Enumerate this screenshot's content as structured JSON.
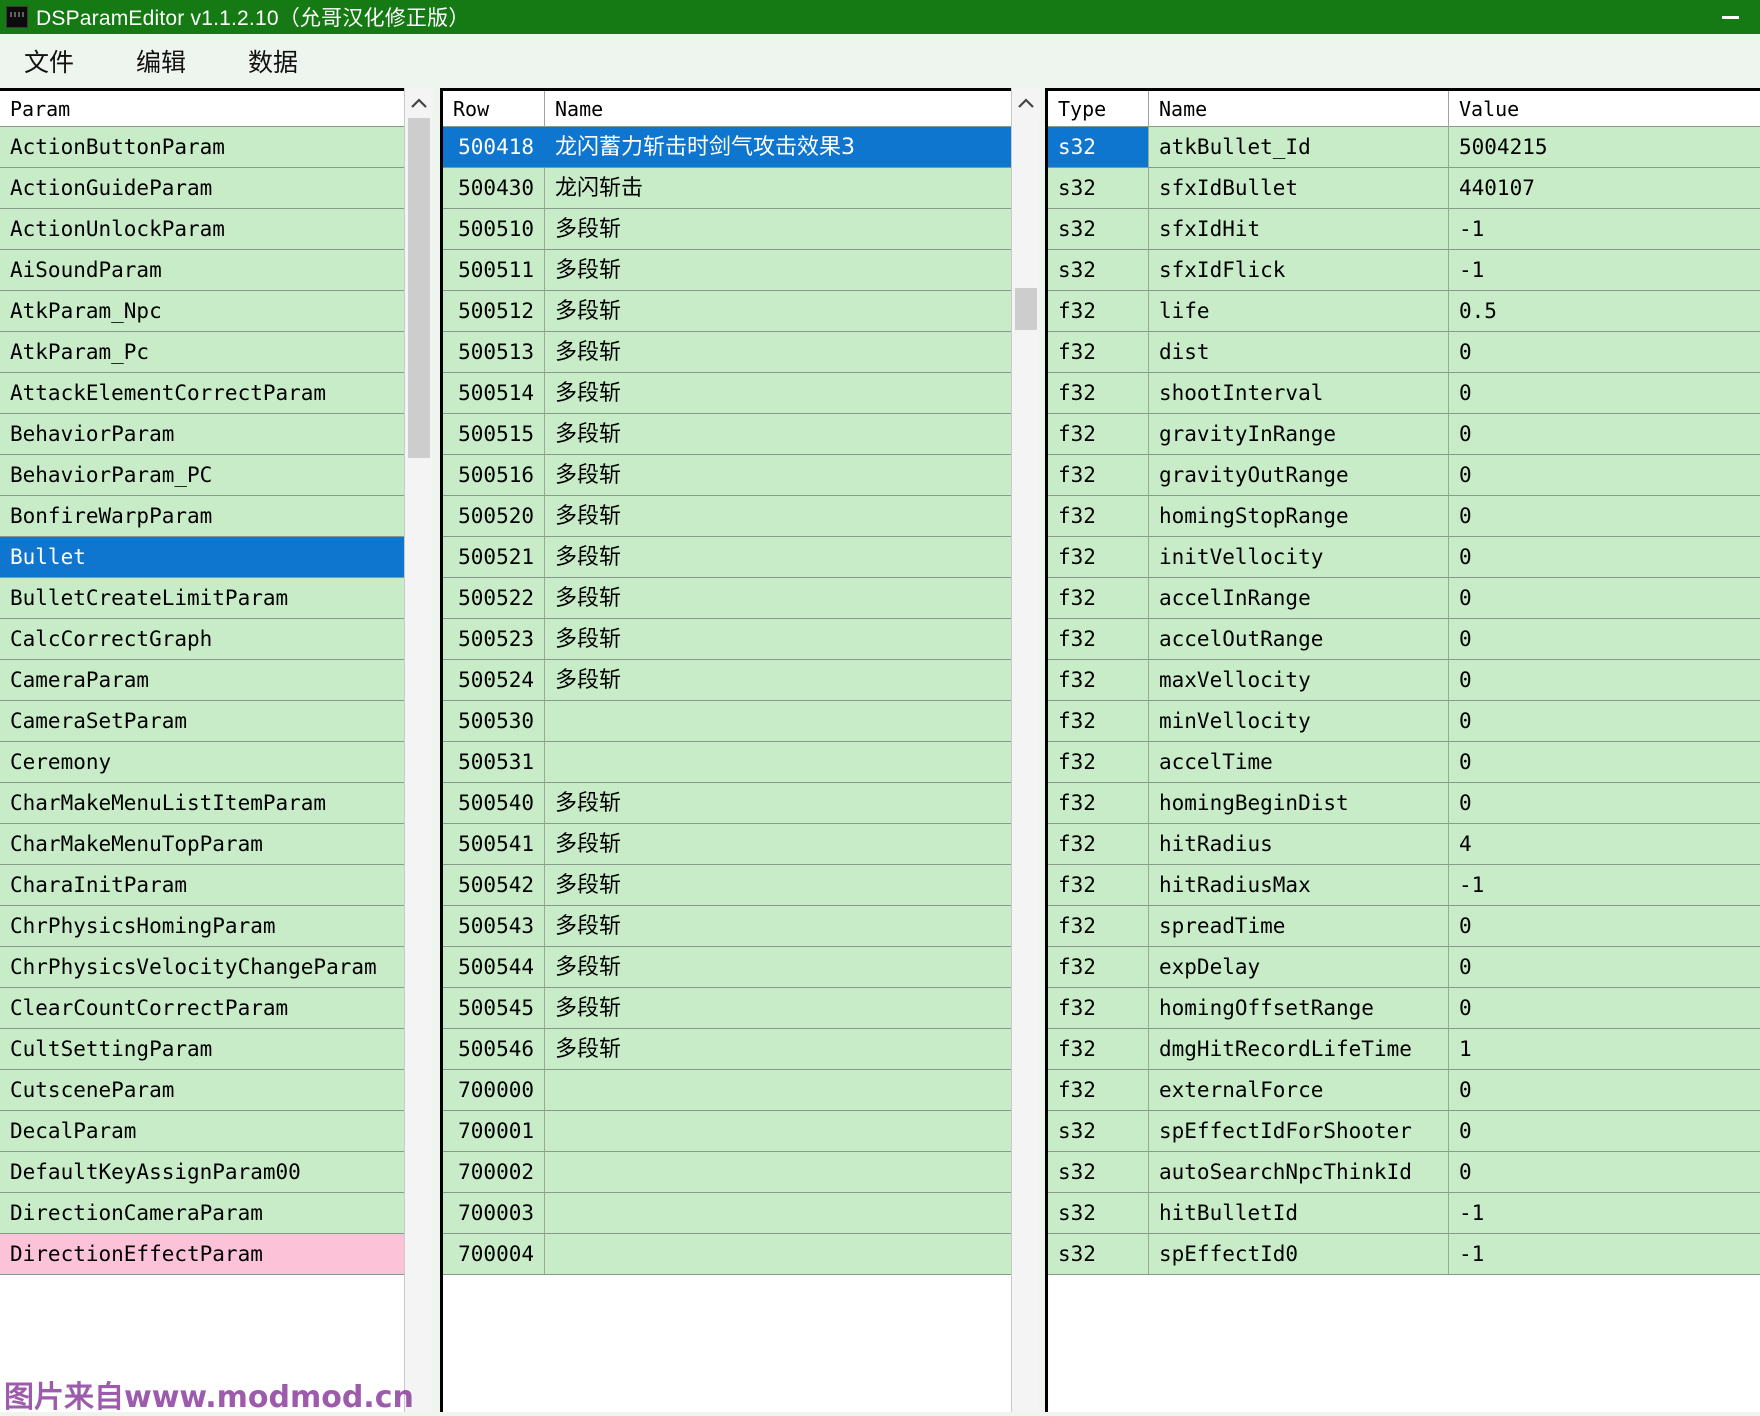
{
  "window": {
    "title": "DSParamEditor v1.1.2.10（允哥汉化修正版）",
    "app_icon": "app-icon",
    "minimize_label": "—",
    "titlebar_color": "#157a14",
    "selection_color": "#0e76ce",
    "row_color": "#c8ecc8",
    "pink_row_color": "#fcc3d8"
  },
  "menubar": {
    "items": [
      {
        "label": "文件"
      },
      {
        "label": "编辑"
      },
      {
        "label": "数据"
      }
    ]
  },
  "param_panel": {
    "header": "Param",
    "selected": "Bullet",
    "items": [
      {
        "label": "ActionButtonParam"
      },
      {
        "label": "ActionGuideParam"
      },
      {
        "label": "ActionUnlockParam"
      },
      {
        "label": "AiSoundParam"
      },
      {
        "label": "AtkParam_Npc"
      },
      {
        "label": "AtkParam_Pc"
      },
      {
        "label": "AttackElementCorrectParam"
      },
      {
        "label": "BehaviorParam"
      },
      {
        "label": "BehaviorParam_PC"
      },
      {
        "label": "BonfireWarpParam"
      },
      {
        "label": "Bullet"
      },
      {
        "label": "BulletCreateLimitParam"
      },
      {
        "label": "CalcCorrectGraph"
      },
      {
        "label": "CameraParam"
      },
      {
        "label": "CameraSetParam"
      },
      {
        "label": "Ceremony"
      },
      {
        "label": "CharMakeMenuListItemParam"
      },
      {
        "label": "CharMakeMenuTopParam"
      },
      {
        "label": "CharaInitParam"
      },
      {
        "label": "ChrPhysicsHomingParam"
      },
      {
        "label": "ChrPhysicsVelocityChangeParam"
      },
      {
        "label": "ClearCountCorrectParam"
      },
      {
        "label": "CultSettingParam"
      },
      {
        "label": "CutsceneParam"
      },
      {
        "label": "DecalParam"
      },
      {
        "label": "DefaultKeyAssignParam00"
      },
      {
        "label": "DirectionCameraParam"
      },
      {
        "label": "DirectionEffectParam"
      }
    ]
  },
  "row_panel": {
    "headers": {
      "row": "Row",
      "name": "Name"
    },
    "selected_row": "500418",
    "rows": [
      {
        "row": "500418",
        "name": "龙闪蓄力斩击时剑气攻击效果3"
      },
      {
        "row": "500430",
        "name": "龙闪斩击"
      },
      {
        "row": "500510",
        "name": "多段斩"
      },
      {
        "row": "500511",
        "name": "多段斩"
      },
      {
        "row": "500512",
        "name": "多段斩"
      },
      {
        "row": "500513",
        "name": "多段斩"
      },
      {
        "row": "500514",
        "name": "多段斩"
      },
      {
        "row": "500515",
        "name": "多段斩"
      },
      {
        "row": "500516",
        "name": "多段斩"
      },
      {
        "row": "500520",
        "name": "多段斩"
      },
      {
        "row": "500521",
        "name": "多段斩"
      },
      {
        "row": "500522",
        "name": "多段斩"
      },
      {
        "row": "500523",
        "name": "多段斩"
      },
      {
        "row": "500524",
        "name": "多段斩"
      },
      {
        "row": "500530",
        "name": ""
      },
      {
        "row": "500531",
        "name": ""
      },
      {
        "row": "500540",
        "name": "多段斩"
      },
      {
        "row": "500541",
        "name": "多段斩"
      },
      {
        "row": "500542",
        "name": "多段斩"
      },
      {
        "row": "500543",
        "name": "多段斩"
      },
      {
        "row": "500544",
        "name": "多段斩"
      },
      {
        "row": "500545",
        "name": "多段斩"
      },
      {
        "row": "500546",
        "name": "多段斩"
      },
      {
        "row": "700000",
        "name": ""
      },
      {
        "row": "700001",
        "name": ""
      },
      {
        "row": "700002",
        "name": ""
      },
      {
        "row": "700003",
        "name": ""
      },
      {
        "row": "700004",
        "name": ""
      }
    ]
  },
  "field_panel": {
    "headers": {
      "type": "Type",
      "name": "Name",
      "value": "Value"
    },
    "selected_field": "atkBullet_Id",
    "fields": [
      {
        "type": "s32",
        "name": "atkBullet_Id",
        "value": "5004215"
      },
      {
        "type": "s32",
        "name": "sfxIdBullet",
        "value": "440107"
      },
      {
        "type": "s32",
        "name": "sfxIdHit",
        "value": "-1"
      },
      {
        "type": "s32",
        "name": "sfxIdFlick",
        "value": "-1"
      },
      {
        "type": "f32",
        "name": "life",
        "value": "0.5"
      },
      {
        "type": "f32",
        "name": "dist",
        "value": "0"
      },
      {
        "type": "f32",
        "name": "shootInterval",
        "value": "0"
      },
      {
        "type": "f32",
        "name": "gravityInRange",
        "value": "0"
      },
      {
        "type": "f32",
        "name": "gravityOutRange",
        "value": "0"
      },
      {
        "type": "f32",
        "name": "homingStopRange",
        "value": "0"
      },
      {
        "type": "f32",
        "name": "initVellocity",
        "value": "0"
      },
      {
        "type": "f32",
        "name": "accelInRange",
        "value": "0"
      },
      {
        "type": "f32",
        "name": "accelOutRange",
        "value": "0"
      },
      {
        "type": "f32",
        "name": "maxVellocity",
        "value": "0"
      },
      {
        "type": "f32",
        "name": "minVellocity",
        "value": "0"
      },
      {
        "type": "f32",
        "name": "accelTime",
        "value": "0"
      },
      {
        "type": "f32",
        "name": "homingBeginDist",
        "value": "0"
      },
      {
        "type": "f32",
        "name": "hitRadius",
        "value": "4"
      },
      {
        "type": "f32",
        "name": "hitRadiusMax",
        "value": "-1"
      },
      {
        "type": "f32",
        "name": "spreadTime",
        "value": "0"
      },
      {
        "type": "f32",
        "name": "expDelay",
        "value": "0"
      },
      {
        "type": "f32",
        "name": "homingOffsetRange",
        "value": "0"
      },
      {
        "type": "f32",
        "name": "dmgHitRecordLifeTime",
        "value": "1"
      },
      {
        "type": "f32",
        "name": "externalForce",
        "value": "0"
      },
      {
        "type": "s32",
        "name": "spEffectIdForShooter",
        "value": "0"
      },
      {
        "type": "s32",
        "name": "autoSearchNpcThinkId",
        "value": "0"
      },
      {
        "type": "s32",
        "name": "hitBulletId",
        "value": "-1"
      },
      {
        "type": "s32",
        "name": "spEffectId0",
        "value": "-1"
      }
    ]
  },
  "watermark": {
    "text": "图片来自www.modmod.cn"
  }
}
